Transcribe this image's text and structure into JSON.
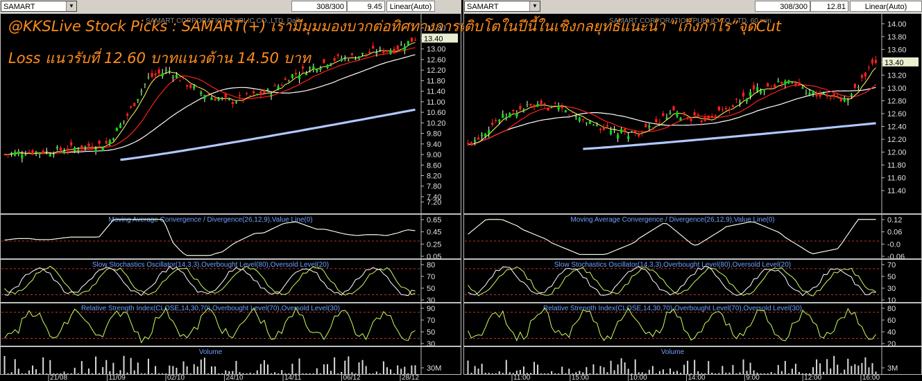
{
  "headline": {
    "line1": "@KKSLive Stock Picks : SAMART(+) เรามีมุมมองบวกต่อทิศทางการเติบโตในปีนี้ในเชิงกลยุทธ์แนะนำ “เก็งกำไร”จุดCut",
    "line2": "Loss แนวรับที่ 12.60 บาทแนวต้าน 14.50 บาท"
  },
  "colors": {
    "up": "#00dd00",
    "down": "#ff2020",
    "ma_red": "#ff2020",
    "ma_white": "#ffffff",
    "ma_blue": "#b0c8ff",
    "osc": "#c8ff60",
    "osc2": "#ffffff",
    "dashed": "#ff4444",
    "title": "#6fa0ff",
    "price_tag": "#e8f0d0"
  },
  "panels": [
    {
      "id": "left",
      "symbol": "SAMART",
      "counter": "308/300",
      "last_value": "9.45",
      "scale": "Linear(Auto)",
      "watermark": "SAMART CORPORATION PUBLIC CO.,LTD.  Daily",
      "price_tag": "13.40",
      "price_axis": {
        "min": 6.9,
        "max": 14.2,
        "ticks": [
          "13.80",
          "13.40",
          "13.00",
          "12.60",
          "12.20",
          "11.80",
          "11.40",
          "11.00",
          "10.60",
          "10.20",
          "9.80",
          "9.40",
          "9.00",
          "8.60",
          "8.20",
          "7.80",
          "7.40",
          "7.20"
        ]
      },
      "indicators": [
        {
          "title": "Moving Average Convergence / Divergence(26,12,9),Value Line(0)",
          "ticks": [
            "0.65",
            "0.45",
            "0.25",
            "0.05"
          ]
        },
        {
          "title": "Slow Stochastics Oscillator(14,3,3),Overbought Level(80),Oversold Level(20)",
          "ticks": [
            "80",
            "70",
            "50",
            "30"
          ]
        },
        {
          "title": "Relative Strength Index(CLOSE,14,30,70),Overbought Level(70),Oversold Level(30)",
          "ticks": [
            "90",
            "70",
            "50",
            "30"
          ]
        },
        {
          "title": "Volume",
          "ticks": [
            "30M"
          ]
        }
      ],
      "date_labels": [
        "21/08",
        "11/09",
        "02/10",
        "24/10",
        "14/11",
        "06/12",
        "28/12"
      ]
    },
    {
      "id": "right",
      "symbol": "SAMART",
      "counter": "308/300",
      "last_value": "12.81",
      "scale": "Linear(Auto)",
      "watermark": "SAMART CORPORATION PUBLIC CO.,LTD.  60 min",
      "price_tag": "13.40",
      "price_axis": {
        "min": 11.1,
        "max": 14.1,
        "ticks": [
          "14.00",
          "13.80",
          "13.60",
          "13.40",
          "13.20",
          "13.00",
          "12.80",
          "12.60",
          "12.40",
          "12.20",
          "12.00",
          "11.80",
          "11.60",
          "11.40"
        ]
      },
      "indicators": [
        {
          "title": "Moving Average Convergence / Divergence(26,12,9),Value Line(0)",
          "ticks": [
            "0.12",
            "0.06",
            "-0.0",
            "-0.06"
          ]
        },
        {
          "title": "Slow Stochastics Oscillator(14,3,3),Overbought Level(80),Oversold Level(20)",
          "ticks": [
            "70",
            "50",
            "30",
            "10"
          ]
        },
        {
          "title": "Relative Strength Index(CLOSE,14,30,70),Overbought Level(70),Oversold Level(30)",
          "ticks": [
            "80",
            "60",
            "40",
            "20"
          ]
        },
        {
          "title": "Volume",
          "ticks": [
            "3M"
          ]
        }
      ],
      "date_labels": [
        "11:00",
        "15:00",
        "10:00",
        "14:00",
        "9:00",
        "12:00",
        "16:00"
      ]
    }
  ],
  "chart_data": [
    {
      "type": "line",
      "panel": "left",
      "timeframe": "daily",
      "price_range": [
        6.9,
        14.2
      ],
      "approx_close": [
        9.0,
        9.1,
        9.1,
        9.2,
        9.3,
        9.4,
        10.5,
        11.9,
        12.2,
        11.6,
        11.2,
        11.0,
        11.2,
        11.4,
        12.0,
        12.3,
        12.6,
        12.7,
        12.9,
        13.0,
        13.4
      ],
      "ma_long_range": [
        8.8,
        10.7
      ]
    },
    {
      "type": "line",
      "panel": "right",
      "timeframe": "60 min",
      "price_range": [
        11.1,
        14.1
      ],
      "approx_close": [
        12.1,
        12.5,
        12.7,
        12.7,
        12.5,
        12.3,
        12.3,
        12.6,
        12.5,
        12.7,
        13.0,
        13.1,
        12.9,
        12.8,
        13.4
      ],
      "ma_long_range": [
        12.05,
        12.45
      ]
    }
  ]
}
